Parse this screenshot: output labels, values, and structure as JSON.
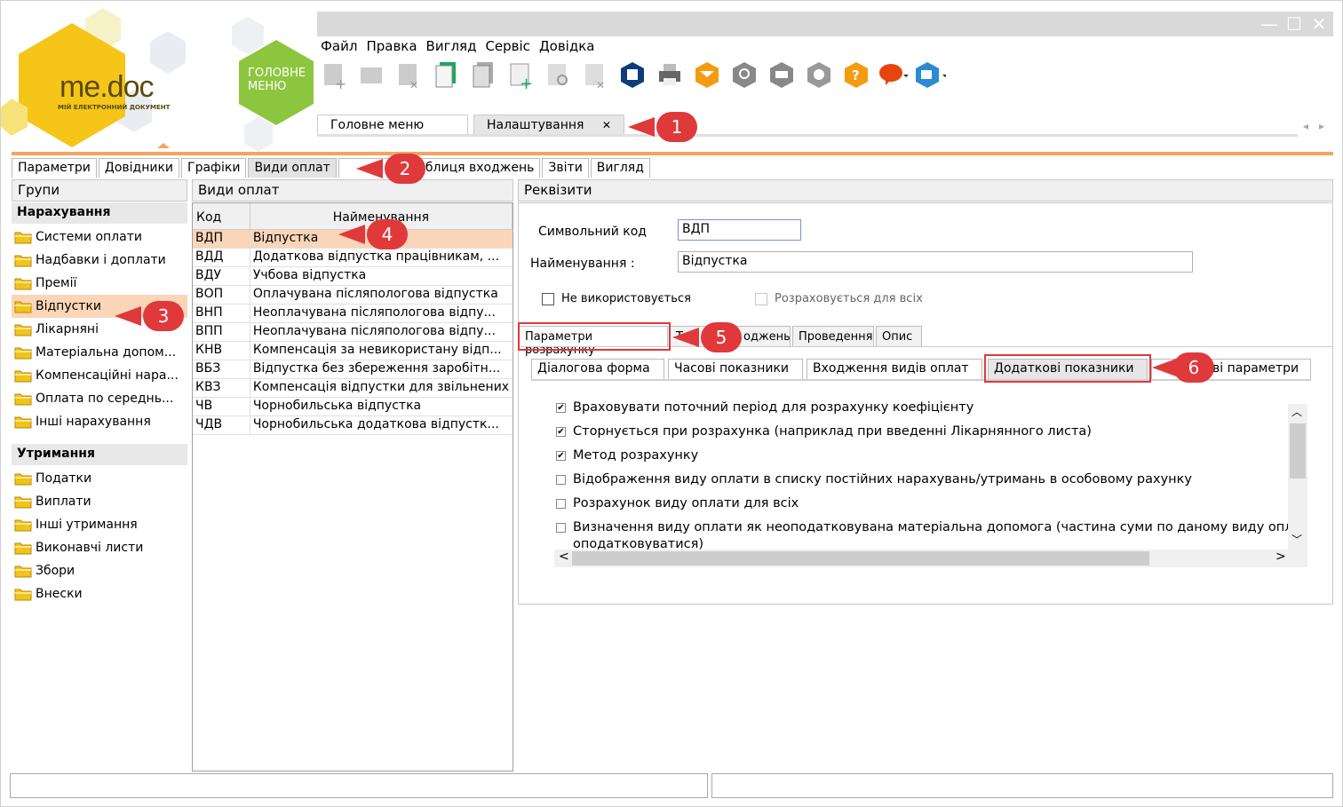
{
  "app": {
    "logo_text": "me.doc",
    "logo_subtitle": "МІЙ ЕЛЕКТРОННИЙ ДОКУМЕНТ",
    "main_menu_badge": "ГОЛОВНЕ МЕНЮ",
    "brand_yellow": "#f5c518",
    "brand_green": "#8cc63f",
    "accent_orange": "#f4a460",
    "callout_red": "#e0393b"
  },
  "menu": [
    "Файл",
    "Правка",
    "Вигляд",
    "Сервіс",
    "Довідка"
  ],
  "doc_tabs": [
    {
      "label": "Головне меню"
    },
    {
      "label": "Налаштування",
      "close": "✕"
    }
  ],
  "main_tabs": [
    "Параметри",
    "Довідники",
    "Графіки",
    "Види оплат",
    "",
    "Таблиця входжень",
    "Звіти",
    "Вигляд"
  ],
  "groups_panel": {
    "title": "Групи",
    "sections": [
      {
        "title": "Нарахування",
        "items": [
          "Системи оплати",
          "Надбавки і доплати",
          "Премії",
          "Відпустки",
          "Лікарняні",
          "Матеріальна допом...",
          "Компенсаційні нара...",
          "Оплата по середнь...",
          "Інші нарахування"
        ]
      },
      {
        "title": "Утримання",
        "items": [
          "Податки",
          "Виплати",
          "Інші утримання",
          "Виконавчі листи",
          "Збори",
          "Внески"
        ]
      }
    ]
  },
  "payments_panel": {
    "title": "Види оплат",
    "col_code": "Код",
    "col_name": "Найменування",
    "rows": [
      {
        "code": "ВДП",
        "name": "Відпустка"
      },
      {
        "code": "ВДД",
        "name": "Додаткова відпустка працівникам, ..."
      },
      {
        "code": "ВДУ",
        "name": "Учбова відпустка"
      },
      {
        "code": "ВОП",
        "name": "Оплачувана післяпологова відпустка"
      },
      {
        "code": "ВНП",
        "name": "Неоплачувана післяпологова відпу..."
      },
      {
        "code": "ВПП",
        "name": "Неоплачувана післяпологова відпу..."
      },
      {
        "code": "КНВ",
        "name": "Компенсація за невикористану відп..."
      },
      {
        "code": "ВБЗ",
        "name": "Відпустка без збереження заробітн..."
      },
      {
        "code": "КВЗ",
        "name": "Компенсація відпустки для звільнених"
      },
      {
        "code": "ЧВ",
        "name": "Чорнобильська відпустка"
      },
      {
        "code": "ЧДВ",
        "name": "Чорнобильська додаткова відпустк..."
      }
    ]
  },
  "requisites": {
    "title": "Реквізити",
    "symbol_code_label": "Символьний код",
    "symbol_code_value": "ВДП",
    "name_label": "Найменування :",
    "name_value": "Відпустка",
    "not_used_label": "Не використовується",
    "calc_all_label": "Розраховується для всіх",
    "param_tabs": [
      "Параметри розрахунку",
      "Т",
      "оджень",
      "Проведення",
      "Опис"
    ],
    "sub_tabs": [
      "Діалогова форма",
      "Часові показники",
      "Входження видів оплат",
      "Додаткові показники",
      "ві параметри"
    ],
    "options": [
      {
        "label": "Враховувати поточний період для розрахунку коефіцієнту",
        "checked": true
      },
      {
        "label": "Сторнується при розрахунка (наприклад при введенні Лікарнянного листа)",
        "checked": true
      },
      {
        "label": "Метод розрахунку",
        "checked": true
      },
      {
        "label": "Відображення виду оплати в списку постійних нарахувань/утримань в особовому рахунку",
        "checked": false
      },
      {
        "label": "Розрахунок виду оплати для всіх",
        "checked": false
      },
      {
        "label": "Визначення виду оплати як неоподатковувана матеріальна допомога (частина суми по даному виду опл",
        "checked": false
      },
      {
        "label": "оподатковуватися)",
        "checked": false
      }
    ]
  },
  "callouts": [
    "1",
    "2",
    "3",
    "4",
    "5",
    "6"
  ],
  "icons": {
    "check": "✔",
    "up": "︿",
    "down": "﹀",
    "left": "<",
    "right": ">",
    "prev": "◂",
    "next": "▸",
    "minimize": "—",
    "maximize": "☐",
    "close": "✕"
  }
}
